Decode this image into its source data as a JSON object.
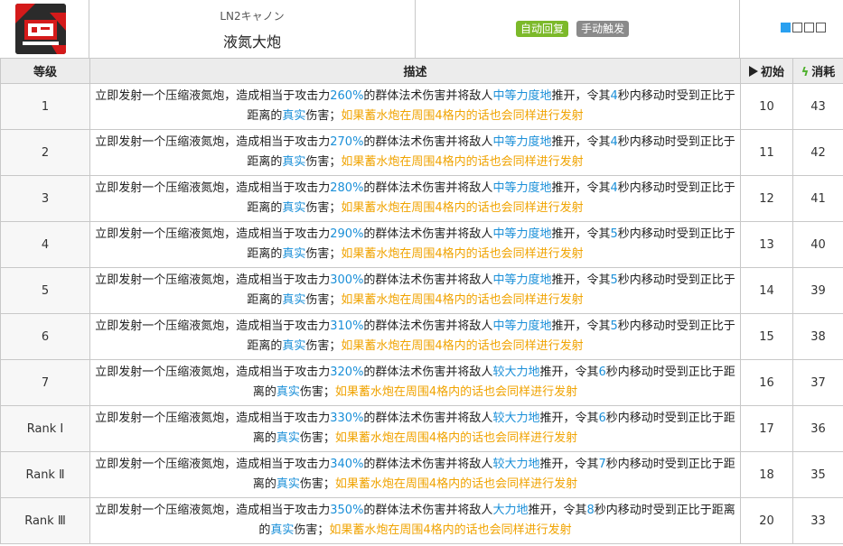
{
  "header": {
    "subname": "LN2キャノン",
    "skill_name": "液氮大炮",
    "badge_auto": "自动回复",
    "badge_manual": "手动触发",
    "icon": "skill-icon"
  },
  "columns": {
    "level": "等级",
    "desc": "描述",
    "initial": "初始",
    "cost": "消耗"
  },
  "rows": [
    {
      "level": "1",
      "p1": "立即发射一个压缩液氮炮，造成相当于攻击力",
      "pct": "260%",
      "p2": "的群体法术伤害并将敌人",
      "force": "中等力度地",
      "p3": "推开，令其",
      "sec": "4",
      "p4": "秒内移动时受到正比于距离的",
      "true": "真实",
      "p5": "伤害；",
      "extra": "如果蓄水炮在周围4格内的话也会同样进行发射",
      "initial": "10",
      "cost": "43"
    },
    {
      "level": "2",
      "p1": "立即发射一个压缩液氮炮，造成相当于攻击力",
      "pct": "270%",
      "p2": "的群体法术伤害并将敌人",
      "force": "中等力度地",
      "p3": "推开，令其",
      "sec": "4",
      "p4": "秒内移动时受到正比于距离的",
      "true": "真实",
      "p5": "伤害；",
      "extra": "如果蓄水炮在周围4格内的话也会同样进行发射",
      "initial": "11",
      "cost": "42"
    },
    {
      "level": "3",
      "p1": "立即发射一个压缩液氮炮，造成相当于攻击力",
      "pct": "280%",
      "p2": "的群体法术伤害并将敌人",
      "force": "中等力度地",
      "p3": "推开，令其",
      "sec": "4",
      "p4": "秒内移动时受到正比于距离的",
      "true": "真实",
      "p5": "伤害；",
      "extra": "如果蓄水炮在周围4格内的话也会同样进行发射",
      "initial": "12",
      "cost": "41"
    },
    {
      "level": "4",
      "p1": "立即发射一个压缩液氮炮，造成相当于攻击力",
      "pct": "290%",
      "p2": "的群体法术伤害并将敌人",
      "force": "中等力度地",
      "p3": "推开，令其",
      "sec": "5",
      "p4": "秒内移动时受到正比于距离的",
      "true": "真实",
      "p5": "伤害；",
      "extra": "如果蓄水炮在周围4格内的话也会同样进行发射",
      "initial": "13",
      "cost": "40"
    },
    {
      "level": "5",
      "p1": "立即发射一个压缩液氮炮，造成相当于攻击力",
      "pct": "300%",
      "p2": "的群体法术伤害并将敌人",
      "force": "中等力度地",
      "p3": "推开，令其",
      "sec": "5",
      "p4": "秒内移动时受到正比于距离的",
      "true": "真实",
      "p5": "伤害；",
      "extra": "如果蓄水炮在周围4格内的话也会同样进行发射",
      "initial": "14",
      "cost": "39"
    },
    {
      "level": "6",
      "p1": "立即发射一个压缩液氮炮，造成相当于攻击力",
      "pct": "310%",
      "p2": "的群体法术伤害并将敌人",
      "force": "中等力度地",
      "p3": "推开，令其",
      "sec": "5",
      "p4": "秒内移动时受到正比于距离的",
      "true": "真实",
      "p5": "伤害；",
      "extra": "如果蓄水炮在周围4格内的话也会同样进行发射",
      "initial": "15",
      "cost": "38"
    },
    {
      "level": "7",
      "p1": "立即发射一个压缩液氮炮，造成相当于攻击力",
      "pct": "320%",
      "p2": "的群体法术伤害并将敌人",
      "force": "较大力地",
      "p3": "推开，令其",
      "sec": "6",
      "p4": "秒内移动时受到正比于距离的",
      "true": "真实",
      "p5": "伤害；",
      "extra": "如果蓄水炮在周围4格内的话也会同样进行发射",
      "initial": "16",
      "cost": "37"
    },
    {
      "level": "Rank Ⅰ",
      "p1": "立即发射一个压缩液氮炮，造成相当于攻击力",
      "pct": "330%",
      "p2": "的群体法术伤害并将敌人",
      "force": "较大力地",
      "p3": "推开，令其",
      "sec": "6",
      "p4": "秒内移动时受到正比于距离的",
      "true": "真实",
      "p5": "伤害；",
      "extra": "如果蓄水炮在周围4格内的话也会同样进行发射",
      "initial": "17",
      "cost": "36"
    },
    {
      "level": "Rank Ⅱ",
      "p1": "立即发射一个压缩液氮炮，造成相当于攻击力",
      "pct": "340%",
      "p2": "的群体法术伤害并将敌人",
      "force": "较大力地",
      "p3": "推开，令其",
      "sec": "7",
      "p4": "秒内移动时受到正比于距离的",
      "true": "真实",
      "p5": "伤害；",
      "extra": "如果蓄水炮在周围4格内的话也会同样进行发射",
      "initial": "18",
      "cost": "35"
    },
    {
      "level": "Rank Ⅲ",
      "p1": "立即发射一个压缩液氮炮，造成相当于攻击力",
      "pct": "350%",
      "p2": "的群体法术伤害并将敌人",
      "force": "大力地",
      "p3": "推开，令其",
      "sec": "8",
      "p4": "秒内移动时受到正比于距离的",
      "true": "真实",
      "p5": "伤害；",
      "extra": "如果蓄水炮在周围4格内的话也会同样进行发射",
      "initial": "20",
      "cost": "33"
    }
  ]
}
